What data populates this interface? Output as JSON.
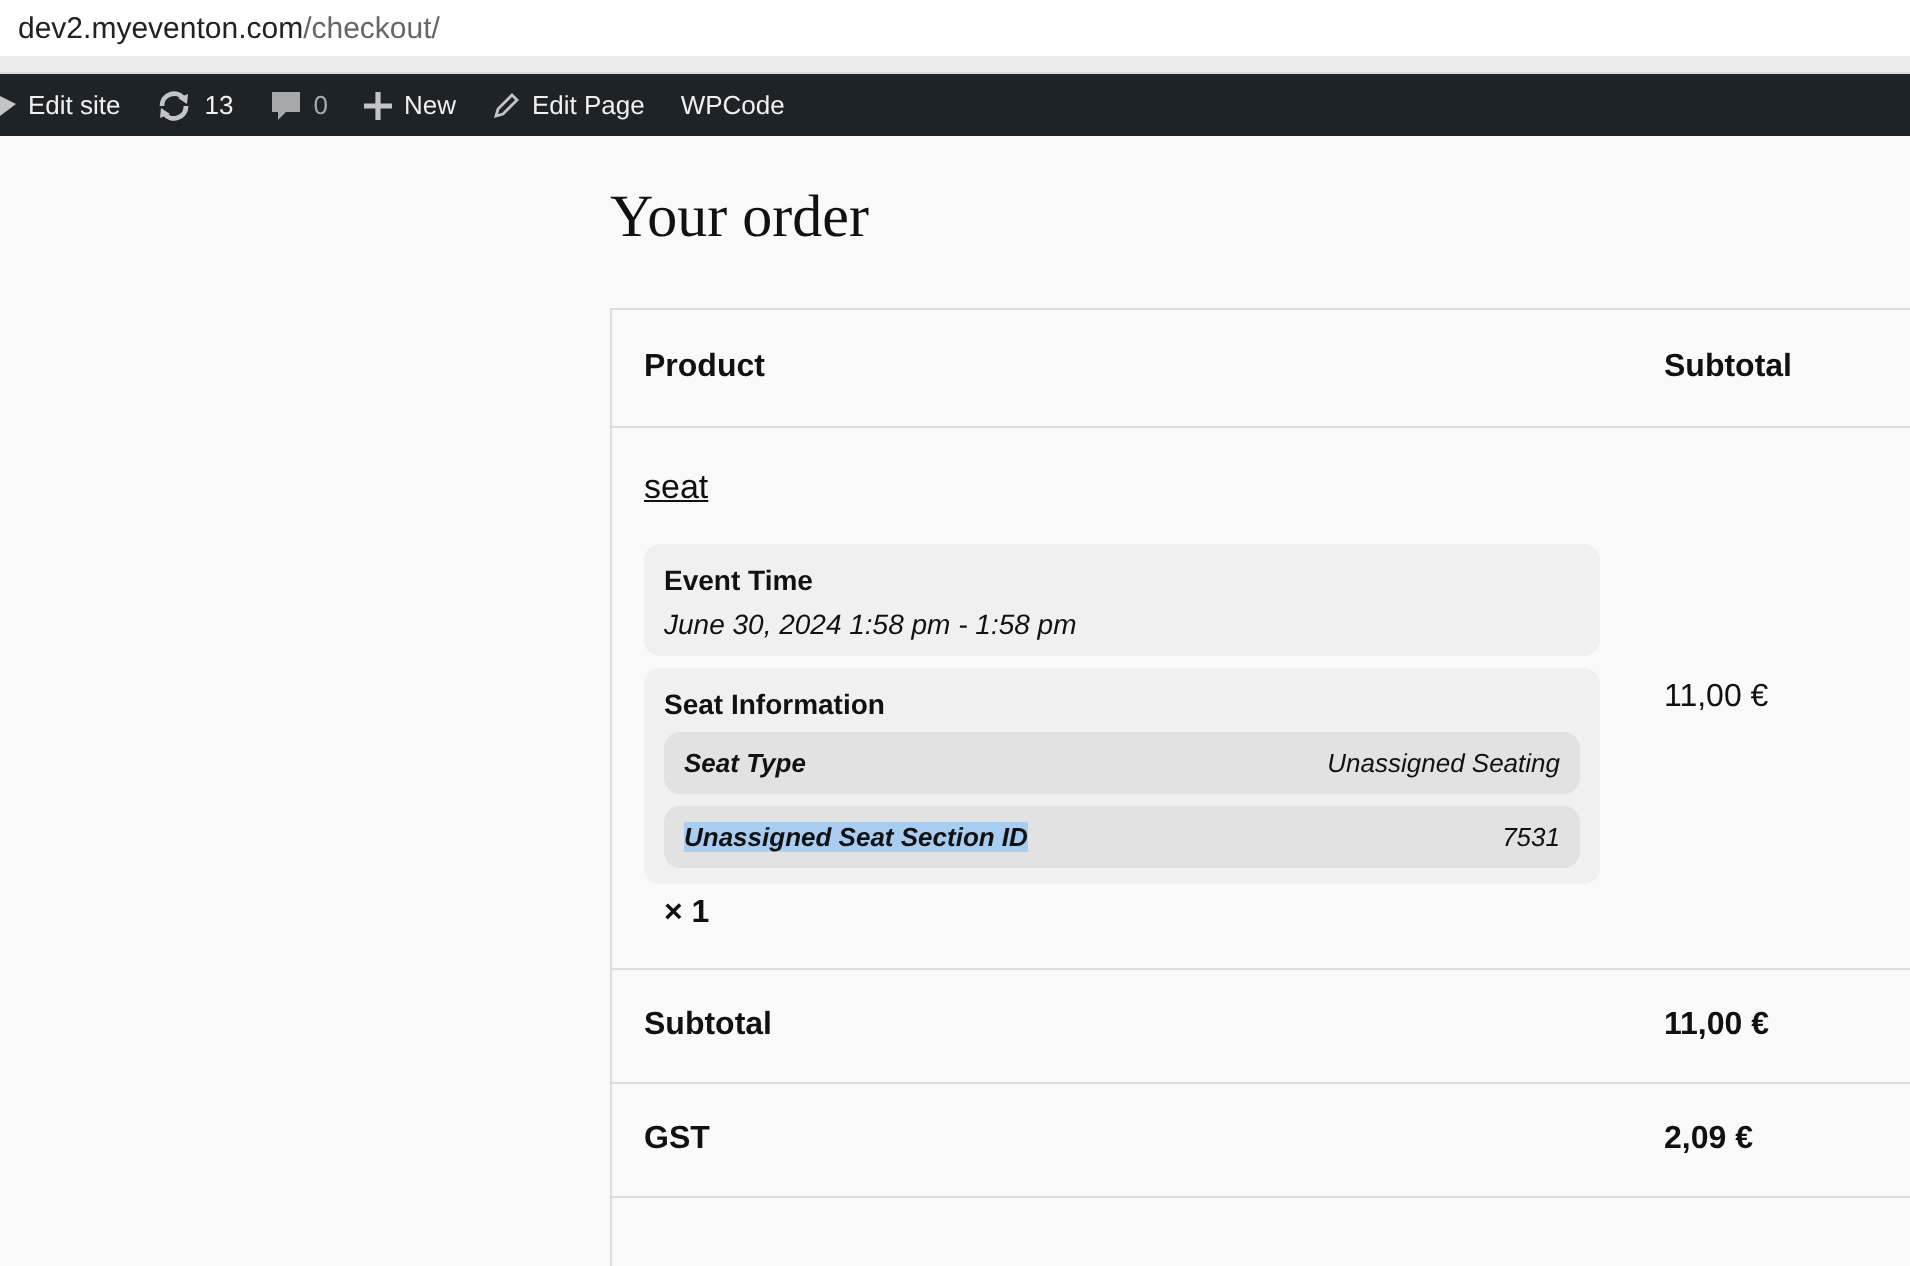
{
  "browser": {
    "url_host": "dev2.myeventon.com",
    "url_path": "/checkout/"
  },
  "admin_bar": {
    "items": [
      {
        "kind": "site",
        "label": "Edit site"
      },
      {
        "kind": "updates",
        "label": "13"
      },
      {
        "kind": "comments",
        "label": "0"
      },
      {
        "kind": "new",
        "label": "New"
      },
      {
        "kind": "edit",
        "label": "Edit Page"
      },
      {
        "kind": "plain",
        "label": "WPCode"
      }
    ]
  },
  "heading": "Your order",
  "table": {
    "columns": [
      "Product",
      "Subtotal"
    ],
    "item": {
      "name": "seat",
      "event_time_label": "Event Time",
      "event_time": "June 30, 2024 1:58 pm - 1:58 pm",
      "seat_info_label": "Seat Information",
      "seat_rows": [
        {
          "label": "Seat Type",
          "value": "Unassigned Seating",
          "selected": false
        },
        {
          "label": "Unassigned Seat Section ID",
          "value": "7531",
          "selected": true
        }
      ],
      "quantity": "× 1",
      "subtotal": "11,00 €"
    },
    "totals": [
      {
        "label": "Subtotal",
        "value": "11,00 €"
      },
      {
        "label": "GST",
        "value": "2,09 €"
      }
    ]
  }
}
